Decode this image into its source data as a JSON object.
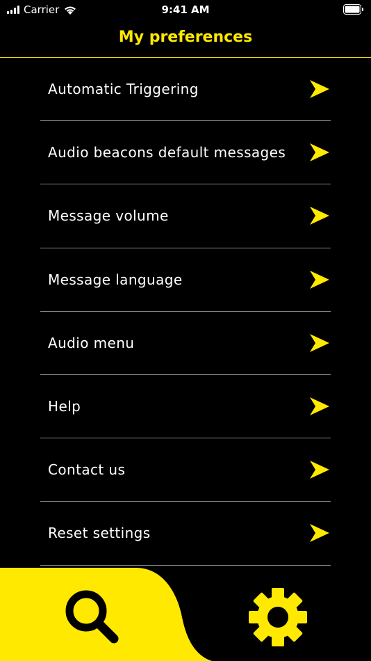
{
  "status_bar": {
    "carrier": "Carrier",
    "time": "9:41 AM",
    "icons": [
      "signal-icon",
      "wifi-icon",
      "battery-icon"
    ]
  },
  "header": {
    "title": "My preferences"
  },
  "menu": {
    "items": [
      {
        "label": "Automatic Triggering"
      },
      {
        "label": "Audio beacons default messages"
      },
      {
        "label": "Message volume"
      },
      {
        "label": "Message language"
      },
      {
        "label": "Audio menu"
      },
      {
        "label": "Help"
      },
      {
        "label": "Contact us"
      },
      {
        "label": "Reset settings"
      }
    ],
    "arrow_icon": "chevron-right-icon"
  },
  "tab_bar": {
    "tabs": [
      {
        "icon": "search-icon",
        "active": true
      },
      {
        "icon": "gear-icon",
        "active": false
      }
    ]
  },
  "colors": {
    "accent": "#ffe900",
    "background": "#000000",
    "text": "#ffffff",
    "divider": "#8b8b8b"
  }
}
